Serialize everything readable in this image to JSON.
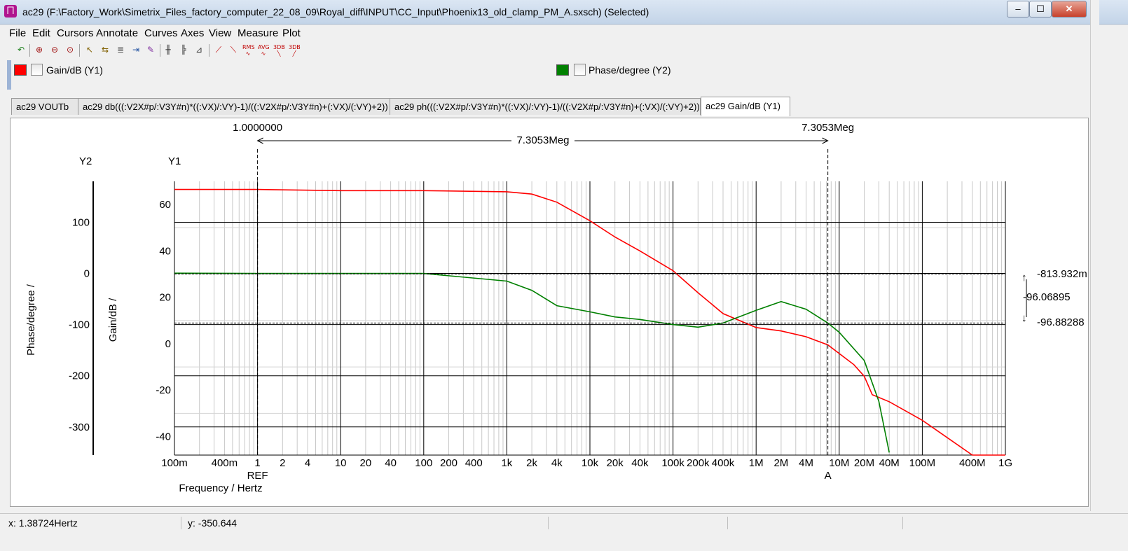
{
  "window": {
    "title": "ac29 (F:\\Factory_Work\\Simetrix_Files_factory_computer_22_08_09\\Royal_diff\\INPUT\\CC_Input\\Phoenix13_old_clamp_PM_A.sxsch) (Selected)",
    "controls": [
      "–",
      "☐",
      "✕"
    ]
  },
  "menu": [
    "File",
    "Edit",
    "Cursors",
    "Annotate",
    "Curves",
    "Axes",
    "View",
    "Measure",
    "Plot"
  ],
  "toolbar": {
    "icons": [
      "undo-icon",
      "zoom-in-icon",
      "zoom-out-icon",
      "zoom-full-icon",
      "cursor-icon",
      "cursor-toggle-icon",
      "label-icon",
      "curve-add-icon",
      "marker-icon",
      "grid-icon",
      "axis-icon",
      "axis-scale-icon",
      "rise-icon",
      "fall-icon",
      "wave-icon",
      "rms-icon",
      "avg-icon",
      "3db-icon",
      "3db-low-icon"
    ],
    "text_labels": {
      "rms": "RMS",
      "avg": "AVG",
      "db3a": "3DB",
      "db3b": "3DB"
    }
  },
  "legend": [
    {
      "label": "Gain/dB (Y1)",
      "color": "#ff0000"
    },
    {
      "label": "Phase/degree (Y2)",
      "color": "#008000"
    }
  ],
  "tabs": [
    "ac29 VOUTb",
    "ac29 db(((:V2X#p/:V3Y#n)*((:VX)/:VY)-1)/((:V2X#p/:V3Y#n)+(:VX)/(:VY)+2))",
    "ac29 ph(((:V2X#p/:V3Y#n)*((:VX)/:VY)-1)/((:V2X#p/:V3Y#n)+(:VX)/(:VY)+2))",
    "ac29 Gain/dB (Y1)"
  ],
  "active_tab": 3,
  "status": {
    "x": "x: 1.38724Hertz",
    "y": "y: -350.644"
  },
  "chart_data": {
    "type": "line",
    "xlabel": "Frequency / Hertz",
    "x_scale": "log",
    "xlim": [
      0.1,
      1000000000
    ],
    "x_ticks": [
      "100m",
      "400m",
      "1",
      "2",
      "4",
      "10",
      "20",
      "40",
      "100",
      "200",
      "400",
      "1k",
      "2k",
      "4k",
      "10k",
      "20k",
      "40k",
      "100k",
      "200k",
      "400k",
      "1M",
      "2M",
      "4M",
      "10M",
      "20M",
      "40M",
      "100M",
      "400M",
      "1G"
    ],
    "y1": {
      "label": "Gain/dB /",
      "axis_name": "Y1",
      "ylim": [
        -48,
        70
      ],
      "ticks": [
        "60",
        "40",
        "20",
        "0",
        "-20",
        "-40"
      ]
    },
    "y2": {
      "label": "Phase/degree /",
      "axis_name": "Y2",
      "ylim": [
        -355,
        180
      ],
      "ticks": [
        "100",
        "0",
        "-100",
        "-200",
        "-300"
      ]
    },
    "grid": true,
    "series": [
      {
        "name": "Gain/dB (Y1)",
        "axis": "y1",
        "color": "#ff0000",
        "x": [
          0.1,
          1,
          10,
          100,
          1000,
          2000,
          4000,
          10000,
          20000,
          40000,
          100000,
          200000,
          400000,
          1000000,
          2000000,
          4000000,
          7305300,
          15000000,
          20000000,
          25000000,
          40000000,
          100000000,
          400000000,
          1000000000
        ],
        "y": [
          66.5,
          66.5,
          66.0,
          66.0,
          65.5,
          64.5,
          61.0,
          53.0,
          46.0,
          40.0,
          31.5,
          22.0,
          13.0,
          7.0,
          5.5,
          3.0,
          -0.5,
          -9.0,
          -14.0,
          -22.0,
          -25.0,
          -33.0,
          -50.0,
          -60.0
        ]
      },
      {
        "name": "Phase/degree (Y2)",
        "axis": "y2",
        "color": "#008000",
        "x": [
          0.1,
          1,
          10,
          100,
          1000,
          2000,
          4000,
          10000,
          20000,
          40000,
          100000,
          200000,
          400000,
          1000000,
          2000000,
          4000000,
          7305300,
          10000000,
          20000000,
          30000000,
          40000000
        ],
        "y": [
          0.5,
          0,
          0,
          0,
          -15,
          -33,
          -63,
          -75,
          -85,
          -90,
          -100,
          -105,
          -97,
          -72,
          -55,
          -70,
          -96.89,
          -115,
          -170,
          -250,
          -350
        ]
      }
    ],
    "cursors": [
      {
        "label": "REF",
        "x": 1,
        "x_readout": "1.0000000"
      },
      {
        "label": "A",
        "x": 7305300,
        "x_readout": "7.3053Meg"
      }
    ],
    "delta_x": "7.3053Meg",
    "right_annotations": [
      "-813.932m",
      "-96.06895",
      "-96.88288"
    ],
    "horizontal_markers_y2": [
      -0.813932,
      -96.88288
    ]
  }
}
